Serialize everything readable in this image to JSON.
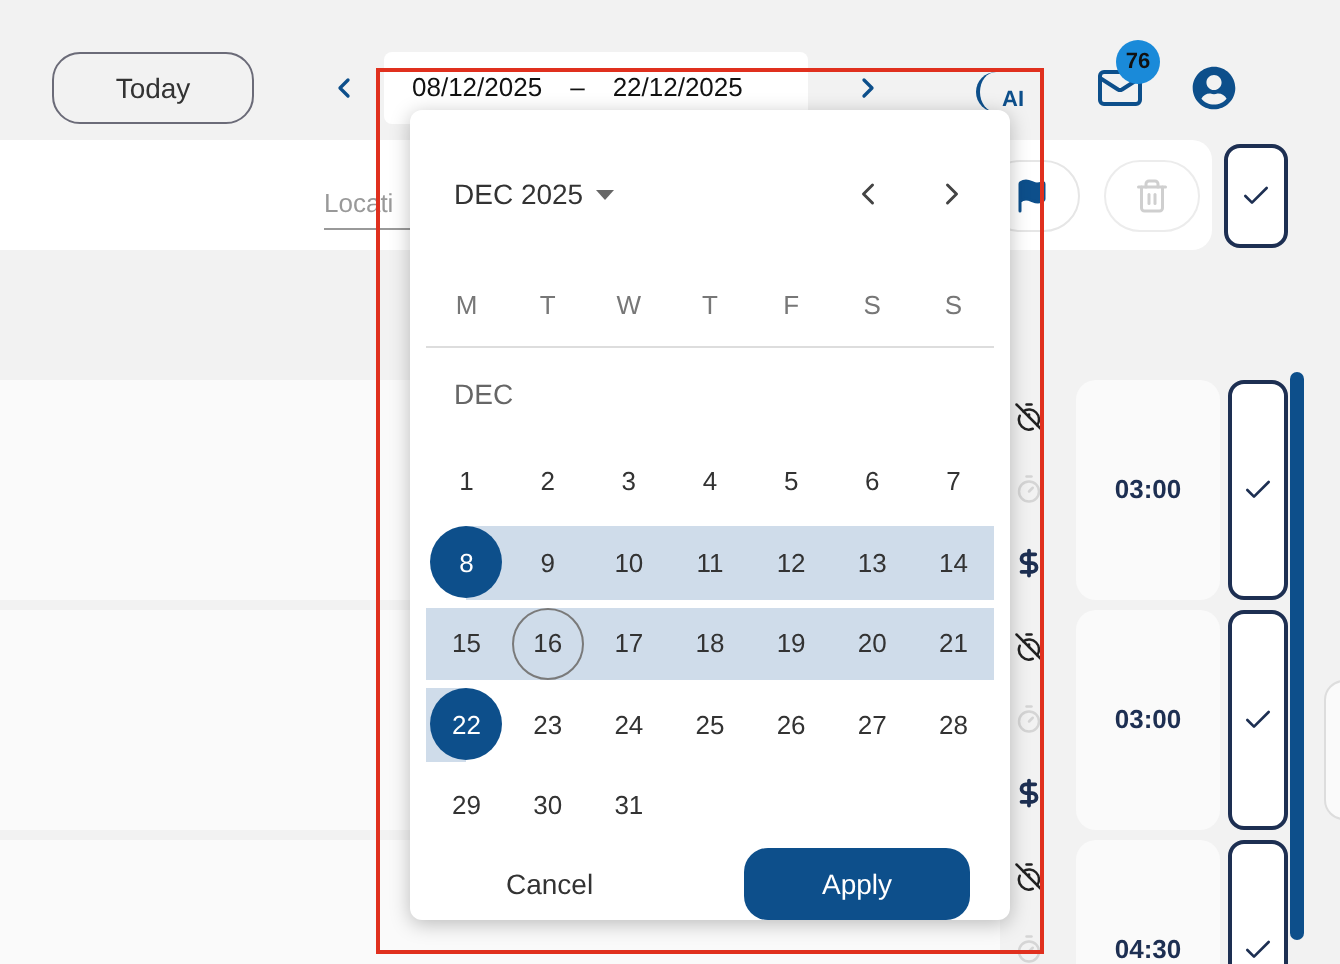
{
  "header": {
    "today_button": "Today",
    "date_range": {
      "start": "08/12/2025",
      "separator": "–",
      "end": "22/12/2025"
    },
    "ai_label": "AI",
    "mail_badge": "76"
  },
  "toolbar": {
    "location_placeholder": "Locati",
    "trash_disabled": true
  },
  "rows": [
    {
      "time": "03:00"
    },
    {
      "time": "03:00"
    },
    {
      "time": "04:30"
    }
  ],
  "date_picker": {
    "month_label": "DEC 2025",
    "weekdays": [
      "M",
      "T",
      "W",
      "T",
      "F",
      "S",
      "S"
    ],
    "section_label": "DEC",
    "days": [
      {
        "label": "1",
        "selected": false,
        "in_range": false,
        "today": false
      },
      {
        "label": "2",
        "selected": false,
        "in_range": false,
        "today": false
      },
      {
        "label": "3",
        "selected": false,
        "in_range": false,
        "today": false
      },
      {
        "label": "4",
        "selected": false,
        "in_range": false,
        "today": false
      },
      {
        "label": "5",
        "selected": false,
        "in_range": false,
        "today": false
      },
      {
        "label": "6",
        "selected": false,
        "in_range": false,
        "today": false
      },
      {
        "label": "7",
        "selected": false,
        "in_range": false,
        "today": false
      },
      {
        "label": "8",
        "selected": true,
        "in_range": true,
        "today": false
      },
      {
        "label": "9",
        "selected": false,
        "in_range": true,
        "today": false
      },
      {
        "label": "10",
        "selected": false,
        "in_range": true,
        "today": false
      },
      {
        "label": "11",
        "selected": false,
        "in_range": true,
        "today": false
      },
      {
        "label": "12",
        "selected": false,
        "in_range": true,
        "today": false
      },
      {
        "label": "13",
        "selected": false,
        "in_range": true,
        "today": false
      },
      {
        "label": "14",
        "selected": false,
        "in_range": true,
        "today": false
      },
      {
        "label": "15",
        "selected": false,
        "in_range": true,
        "today": false
      },
      {
        "label": "16",
        "selected": false,
        "in_range": true,
        "today": true
      },
      {
        "label": "17",
        "selected": false,
        "in_range": true,
        "today": false
      },
      {
        "label": "18",
        "selected": false,
        "in_range": true,
        "today": false
      },
      {
        "label": "19",
        "selected": false,
        "in_range": true,
        "today": false
      },
      {
        "label": "20",
        "selected": false,
        "in_range": true,
        "today": false
      },
      {
        "label": "21",
        "selected": false,
        "in_range": true,
        "today": false
      },
      {
        "label": "22",
        "selected": true,
        "in_range": true,
        "today": false
      },
      {
        "label": "23",
        "selected": false,
        "in_range": false,
        "today": false
      },
      {
        "label": "24",
        "selected": false,
        "in_range": false,
        "today": false
      },
      {
        "label": "25",
        "selected": false,
        "in_range": false,
        "today": false
      },
      {
        "label": "26",
        "selected": false,
        "in_range": false,
        "today": false
      },
      {
        "label": "27",
        "selected": false,
        "in_range": false,
        "today": false
      },
      {
        "label": "28",
        "selected": false,
        "in_range": false,
        "today": false
      },
      {
        "label": "29",
        "selected": false,
        "in_range": false,
        "today": false
      },
      {
        "label": "30",
        "selected": false,
        "in_range": false,
        "today": false
      },
      {
        "label": "31",
        "selected": false,
        "in_range": false,
        "today": false
      }
    ],
    "cancel": "Cancel",
    "apply": "Apply"
  }
}
